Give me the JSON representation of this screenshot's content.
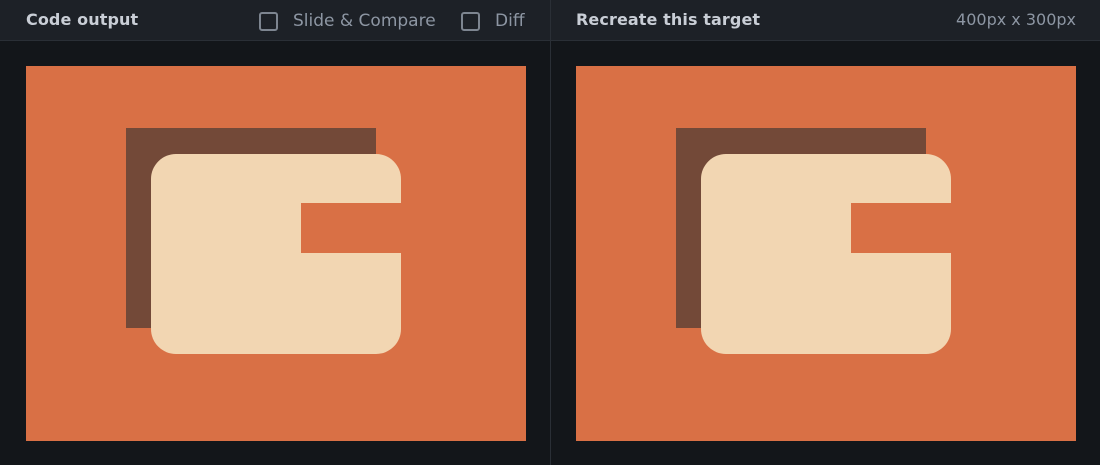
{
  "left_panel": {
    "title": "Code output",
    "options": [
      {
        "label": "Slide & Compare",
        "checked": false
      },
      {
        "label": "Diff",
        "checked": false
      }
    ]
  },
  "right_panel": {
    "title": "Recreate this target",
    "dimensions": "400px x 300px"
  },
  "colors": {
    "app_background": "#13161a",
    "header_background": "#1d2127",
    "canvas_background": "#d97045",
    "back_square": "#734938",
    "front_shape": "#f2d6b2"
  }
}
